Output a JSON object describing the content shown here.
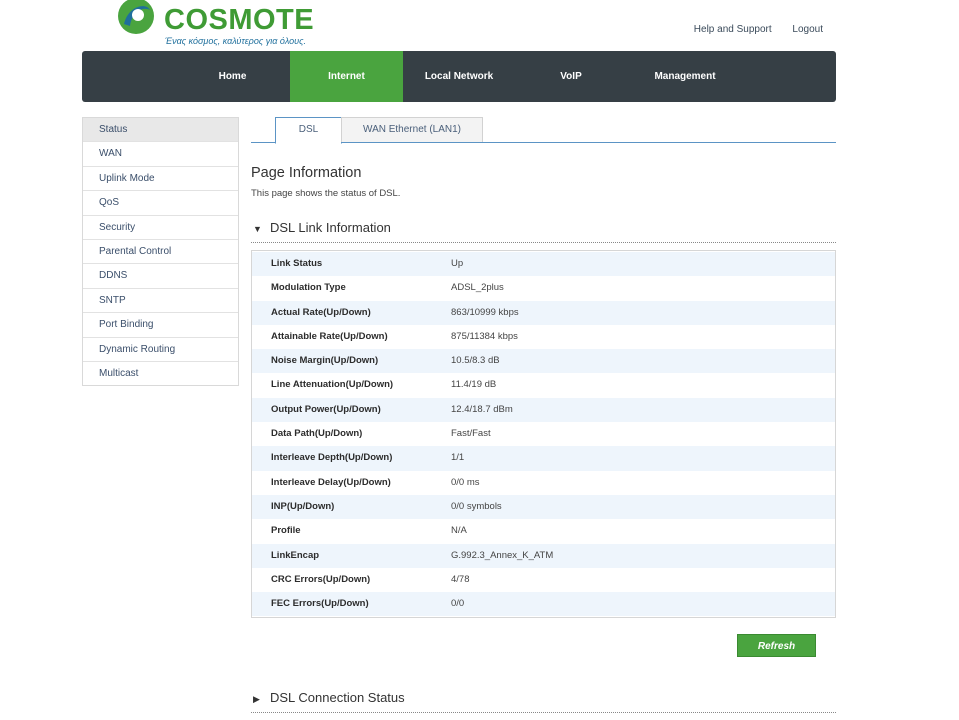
{
  "logo": {
    "brand": "COSMOTE",
    "tagline": "Ένας κόσμος, καλύτερος για όλους."
  },
  "toplinks": {
    "help": "Help and Support",
    "logout": "Logout"
  },
  "nav": {
    "items": [
      {
        "label": "Home"
      },
      {
        "label": "Internet"
      },
      {
        "label": "Local Network"
      },
      {
        "label": "VoIP"
      },
      {
        "label": "Management"
      }
    ],
    "active": "Internet"
  },
  "sidebar": {
    "items": [
      {
        "label": "Status"
      },
      {
        "label": "WAN"
      },
      {
        "label": "Uplink Mode"
      },
      {
        "label": "QoS"
      },
      {
        "label": "Security"
      },
      {
        "label": "Parental Control"
      },
      {
        "label": "DDNS"
      },
      {
        "label": "SNTP"
      },
      {
        "label": "Port Binding"
      },
      {
        "label": "Dynamic Routing"
      },
      {
        "label": "Multicast"
      }
    ],
    "active": "Status"
  },
  "tabs": [
    {
      "label": "DSL"
    },
    {
      "label": "WAN Ethernet (LAN1)"
    }
  ],
  "page_info": {
    "title": "Page Information",
    "desc": "This page shows the status of DSL."
  },
  "dsl_link": {
    "title": "DSL Link Information",
    "rows": [
      {
        "label": "Link Status",
        "value": "Up"
      },
      {
        "label": "Modulation Type",
        "value": "ADSL_2plus"
      },
      {
        "label": "Actual Rate(Up/Down)",
        "value": "863/10999 kbps"
      },
      {
        "label": "Attainable Rate(Up/Down)",
        "value": "875/11384 kbps"
      },
      {
        "label": "Noise Margin(Up/Down)",
        "value": "10.5/8.3 dB"
      },
      {
        "label": "Line Attenuation(Up/Down)",
        "value": "11.4/19 dB"
      },
      {
        "label": "Output Power(Up/Down)",
        "value": "12.4/18.7 dBm"
      },
      {
        "label": "Data Path(Up/Down)",
        "value": "Fast/Fast"
      },
      {
        "label": "Interleave Depth(Up/Down)",
        "value": "1/1"
      },
      {
        "label": "Interleave Delay(Up/Down)",
        "value": "0/0 ms"
      },
      {
        "label": "INP(Up/Down)",
        "value": "0/0 symbols"
      },
      {
        "label": "Profile",
        "value": "N/A"
      },
      {
        "label": "LinkEncap",
        "value": "G.992.3_Annex_K_ATM"
      },
      {
        "label": "CRC Errors(Up/Down)",
        "value": "4/78"
      },
      {
        "label": "FEC Errors(Up/Down)",
        "value": "0/0"
      }
    ]
  },
  "refresh_label": "Refresh",
  "dsl_conn": {
    "title": "DSL Connection Status"
  },
  "colors": {
    "accent": "#4aa43f",
    "navbar": "#363f45",
    "tab_border": "#5b94c5"
  }
}
